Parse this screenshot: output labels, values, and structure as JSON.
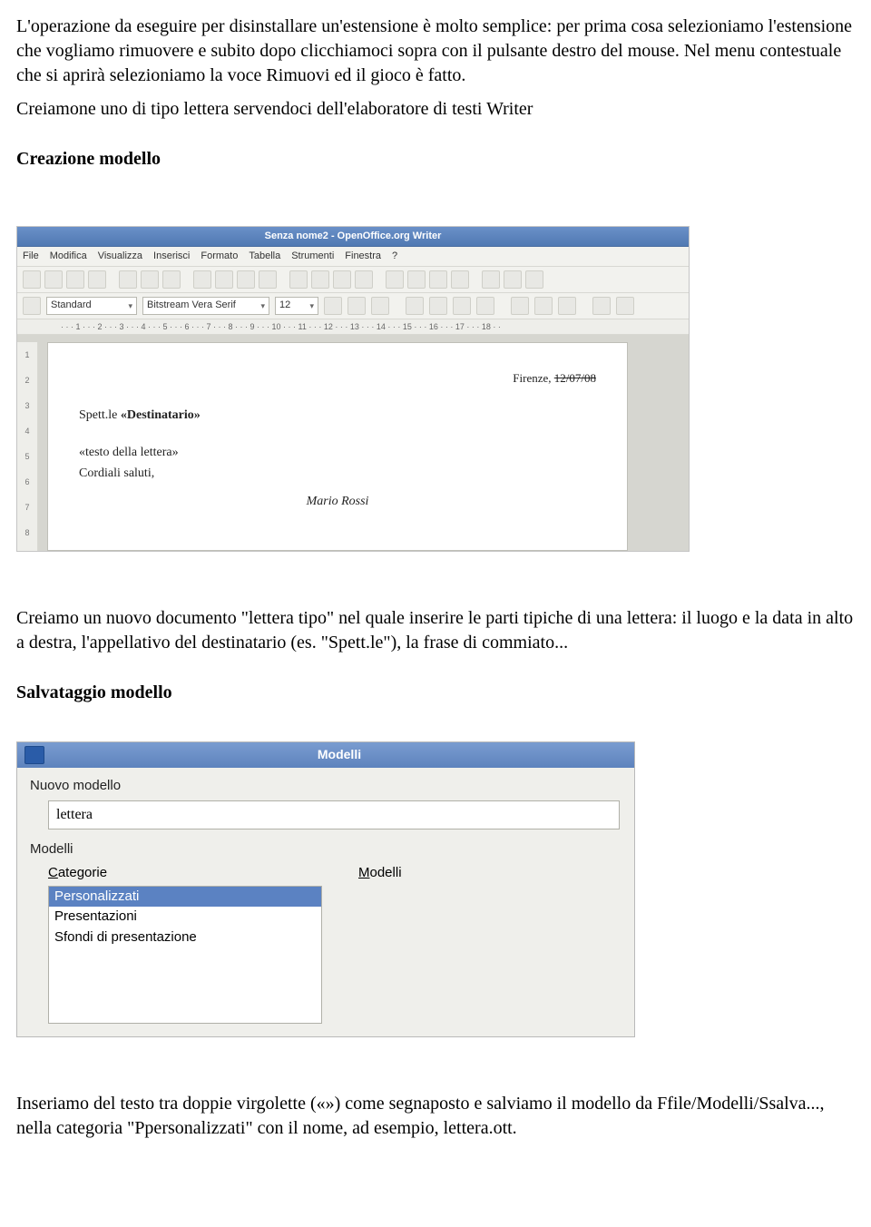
{
  "para1": "L'operazione da eseguire per disinstallare un'estensione è molto semplice: per prima cosa selezioniamo l'estensione che vogliamo rimuovere e subito dopo clicchiamoci sopra con il pulsante destro del mouse. Nel menu contestuale che si aprirà selezioniamo la voce Rimuovi ed il gioco è fatto.",
  "para2": "Creiamone uno di tipo lettera servendoci dell'elaboratore di testi Writer",
  "heading1": "Creazione modello",
  "writer": {
    "title": "Senza nome2 - OpenOffice.org Writer",
    "menu": [
      "File",
      "Modifica",
      "Visualizza",
      "Inserisci",
      "Formato",
      "Tabella",
      "Strumenti",
      "Finestra",
      "?"
    ],
    "style": "Standard",
    "font": "Bitstream Vera Serif",
    "size": "12",
    "ruler": "· · · 1 · · · 2 · · · 3 · · · 4 · · · 5 · · · 6 · · · 7 · · · 8 · · · 9 · · · 10 · · · 11 · · · 12 · · · 13 · · · 14 · · · 15 · · · 16 · · · 17 · · · 18 · ·",
    "vruler": [
      "1",
      "2",
      "3",
      "4",
      "5",
      "6",
      "7",
      "8"
    ],
    "doc": {
      "date_city": "Firenze, ",
      "date_value": "12/07/08",
      "recipient_prefix": "Spett.le ",
      "recipient_field": "«Destinatario»",
      "body": "«testo della lettera»",
      "closing": "Cordiali saluti,",
      "signature": "Mario Rossi"
    }
  },
  "para3": "Creiamo un nuovo documento \"lettera tipo\" nel quale inserire le parti tipiche di una lettera: il luogo e la data in alto a destra, l'appellativo del destinatario (es. \"Spett.le\"), la frase di commiato...",
  "heading2": "Salvataggio modello",
  "dlg": {
    "title": "Modelli",
    "group1": "Nuovo modello",
    "input_value": "lettera",
    "group2": "Modelli",
    "col1": "Categorie",
    "col2": "Modelli",
    "categories": [
      "Personalizzati",
      "Presentazioni",
      "Sfondi di presentazione"
    ]
  },
  "para4": "Inseriamo del testo tra doppie virgolette («») come segnaposto e salviamo il modello da Ffile/Modelli/Ssalva..., nella categoria \"Ppersonalizzati\" con il nome, ad esempio, lettera.ott."
}
